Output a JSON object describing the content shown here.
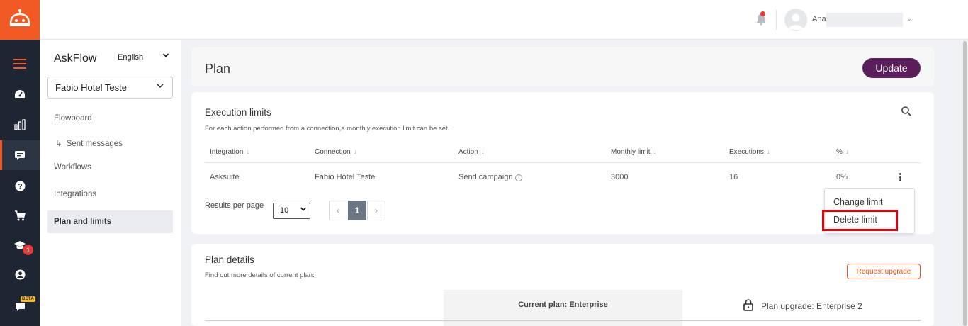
{
  "app": {
    "title": "AskFlow",
    "language": "English",
    "property": "Fabio Hotel Teste",
    "brand_color": "#f15a24"
  },
  "rail": {
    "icons": [
      "menu-icon",
      "dashboard-icon",
      "chart-icon",
      "chat-icon",
      "help-icon",
      "cart-icon",
      "graduation-cap-icon",
      "user-circle-icon",
      "chat-beta-icon"
    ],
    "badge": "1",
    "beta_label": "BETA"
  },
  "topbar": {
    "user_name": "Ana"
  },
  "sidebar": {
    "items": [
      "Flowboard",
      "Sent messages",
      "Workflows",
      "Integrations",
      "Plan and limits"
    ],
    "active": "Plan and limits"
  },
  "page": {
    "title": "Plan",
    "update_label": "Update"
  },
  "execution_limits": {
    "title": "Execution limits",
    "subtitle": "For each action performed from a connection,a monthly execution limit can be set.",
    "columns": [
      "Integration",
      "Connection",
      "Action",
      "Monthly limit",
      "Executions",
      "%"
    ],
    "rows": [
      {
        "integration": "Asksuite",
        "connection": "Fabio Hotel Teste",
        "action": "Send campaign",
        "monthly_limit": "3000",
        "executions": "16",
        "percent": "0%"
      }
    ],
    "results_per_page_label": "Results per page",
    "results_per_page": "10",
    "current_page": "1"
  },
  "row_menu": {
    "items": [
      "Change limit",
      "Delete limit"
    ],
    "highlighted": "Delete limit"
  },
  "plan_details": {
    "title": "Plan details",
    "subtitle": "Find out more details of current plan.",
    "request_upgrade_label": "Request upgrade",
    "current_plan": "Current plan: Enterprise",
    "upgrade_plan": "Plan upgrade: Enterprise 2"
  }
}
